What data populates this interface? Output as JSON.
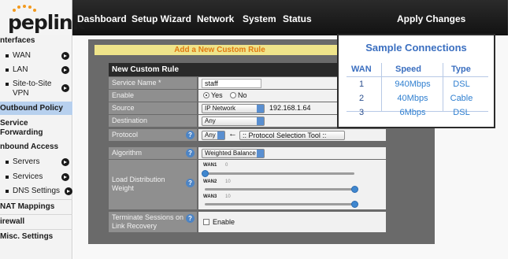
{
  "brand": {
    "logo_text": "peplink",
    "accent": "#f29a1f"
  },
  "nav": {
    "tabs": [
      {
        "label": "Dashboard"
      },
      {
        "label": "Setup Wizard"
      },
      {
        "label": "Network"
      },
      {
        "label": "System"
      },
      {
        "label": "Status"
      }
    ],
    "apply_label": "Apply Changes",
    "active_tab": "Network"
  },
  "sidebar": {
    "interfaces_heading": "nterfaces",
    "wan": "WAN",
    "lan": "LAN",
    "site_to_site": "Site-to-Site VPN",
    "outbound_policy": "Outbound Policy",
    "service_forwarding": "Service Forwarding",
    "inbound_access": "nbound Access",
    "servers": "Servers",
    "services": "Services",
    "dns_settings": "DNS Settings",
    "nat_mappings": "NAT Mappings",
    "firewall": "irewall",
    "misc_settings": "Misc. Settings"
  },
  "dialog": {
    "title": "Add a New Custom Rule",
    "form_heading": "New Custom Rule",
    "fields": {
      "service_name": {
        "label": "Service Name *",
        "value": "staff"
      },
      "enable": {
        "label": "Enable",
        "yes": "Yes",
        "no": "No",
        "selected": "Yes"
      },
      "source": {
        "label": "Source",
        "type": "IP Network",
        "value": "192.168.1.64"
      },
      "destination": {
        "label": "Destination",
        "value": "Any"
      },
      "protocol": {
        "label": "Protocol",
        "value": "Any",
        "tool": ":: Protocol Selection Tool ::"
      },
      "algorithm": {
        "label": "Algorithm",
        "value": "Weighted Balance"
      },
      "load_distribution": {
        "label": "Load Distribution Weight",
        "wans": [
          {
            "name": "WAN1",
            "weight": "0",
            "level": 0.0
          },
          {
            "name": "WAN2",
            "weight": "10",
            "level": 1.0
          },
          {
            "name": "WAN3",
            "weight": "10",
            "level": 1.0
          }
        ]
      },
      "terminate": {
        "label": "Terminate Sessions on Link Recovery",
        "option": "Enable"
      }
    },
    "help_glyph": "?"
  },
  "overlay": {
    "title": "Sample Connections",
    "headers": [
      "WAN",
      "Speed",
      "Type"
    ],
    "rows": [
      {
        "wan": "1",
        "speed": "940Mbps",
        "type": "DSL"
      },
      {
        "wan": "2",
        "speed": "40Mbps",
        "type": "Cable"
      },
      {
        "wan": "3",
        "speed": "6Mbps",
        "type": "DSL"
      }
    ],
    "colors": {
      "title": "#3b6fc0",
      "cell": "#2f7fd0"
    }
  }
}
